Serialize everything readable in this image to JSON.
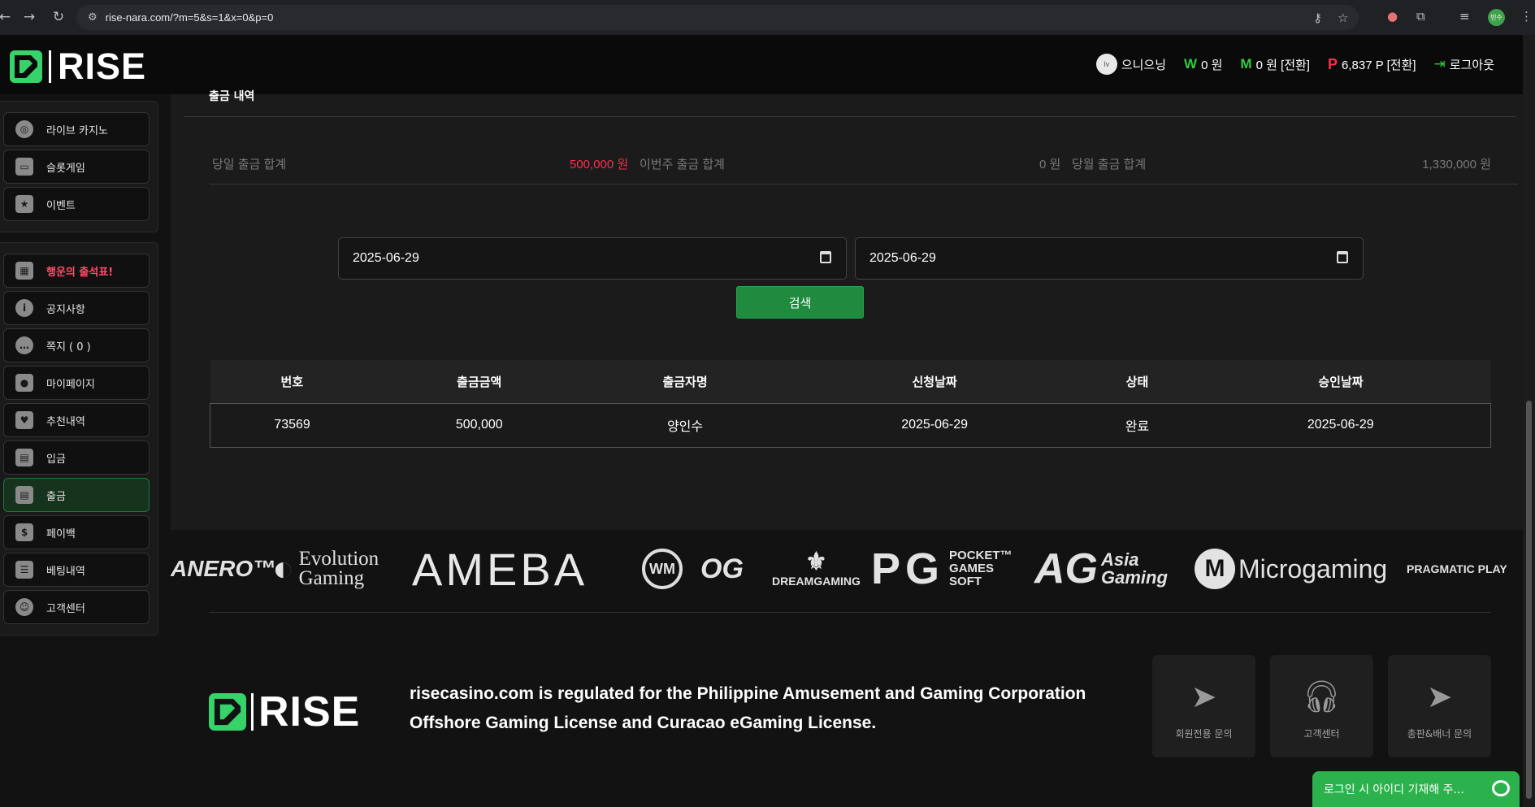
{
  "browser": {
    "url": "rise-nara.com/?m=5&s=1&x=0&p=0",
    "profile_initials": "민수"
  },
  "header": {
    "brand": "RISE",
    "nickname": "으니으닝",
    "won_symbol": "W",
    "won_balance": "0 원",
    "m_symbol": "M",
    "m_balance": "0 원 [전환]",
    "p_symbol": "P",
    "points": "6,837 P [전환]",
    "logout": "로그아웃",
    "level_badge": "lv"
  },
  "sidebar": {
    "group1": [
      {
        "label": "라이브 카지노",
        "icon": "casino-chips-icon"
      },
      {
        "label": "슬롯게임",
        "icon": "slot-machine-icon"
      },
      {
        "label": "이벤트",
        "icon": "star-badge-icon"
      }
    ],
    "group2": [
      {
        "label": "행운의 출석표!",
        "icon": "calendar-icon"
      },
      {
        "label": "공지사항",
        "icon": "info-icon"
      },
      {
        "label": "쪽지 ( 0 )",
        "icon": "message-icon"
      },
      {
        "label": "마이페이지",
        "icon": "user-icon"
      },
      {
        "label": "추천내역",
        "icon": "heart-icon"
      },
      {
        "label": "입금",
        "icon": "wallet-in-icon"
      },
      {
        "label": "출금",
        "icon": "wallet-out-icon"
      },
      {
        "label": "페이백",
        "icon": "coin-stack-icon"
      },
      {
        "label": "베팅내역",
        "icon": "list-icon"
      },
      {
        "label": "고객센터",
        "icon": "support-icon"
      }
    ]
  },
  "main": {
    "section_title": "출금 내역",
    "summary": {
      "today_label": "당일 출금 합계",
      "today_value": "500,000 원",
      "week_label": "이번주 출금 합계",
      "week_value": "0 원",
      "month_label": "당월 출금 합계",
      "month_value": "1,330,000 원"
    },
    "date_from": "2025-06-29",
    "date_to": "2025-06-29",
    "search_label": "검색",
    "table": {
      "headers": [
        "번호",
        "출금금액",
        "출금자명",
        "신청날짜",
        "상태",
        "승인날짜"
      ],
      "rows": [
        [
          "73569",
          "500,000",
          "양인수",
          "2025-06-29",
          "완료",
          "2025-06-29"
        ]
      ]
    }
  },
  "providers": [
    "ANERO™",
    "Evolution Gaming",
    "AMEBA",
    "WM",
    "OG",
    "DREAMGAMING",
    "PG",
    "POCKET™ GAMES SOFT",
    "AG",
    "Asia Gaming",
    "Microgaming",
    "PRAGMATIC PLAY"
  ],
  "footer": {
    "brand": "RISE",
    "text": "risecasino.com is regulated for the Philippine Amusement and Gaming Corporation Offshore Gaming License and Curacao eGaming License.",
    "contacts": [
      {
        "label": "회원전용 문의",
        "icon": "telegram-icon"
      },
      {
        "label": "고객센터",
        "icon": "headset-icon"
      },
      {
        "label": "총판&배너 문의",
        "icon": "telegram-icon"
      }
    ]
  },
  "chat": {
    "label": "로그인 시 아이디 기재해 주..."
  },
  "colors": {
    "accent_green": "#1f8b3e",
    "accent_red": "#ff2d4a",
    "background": "#121212"
  }
}
